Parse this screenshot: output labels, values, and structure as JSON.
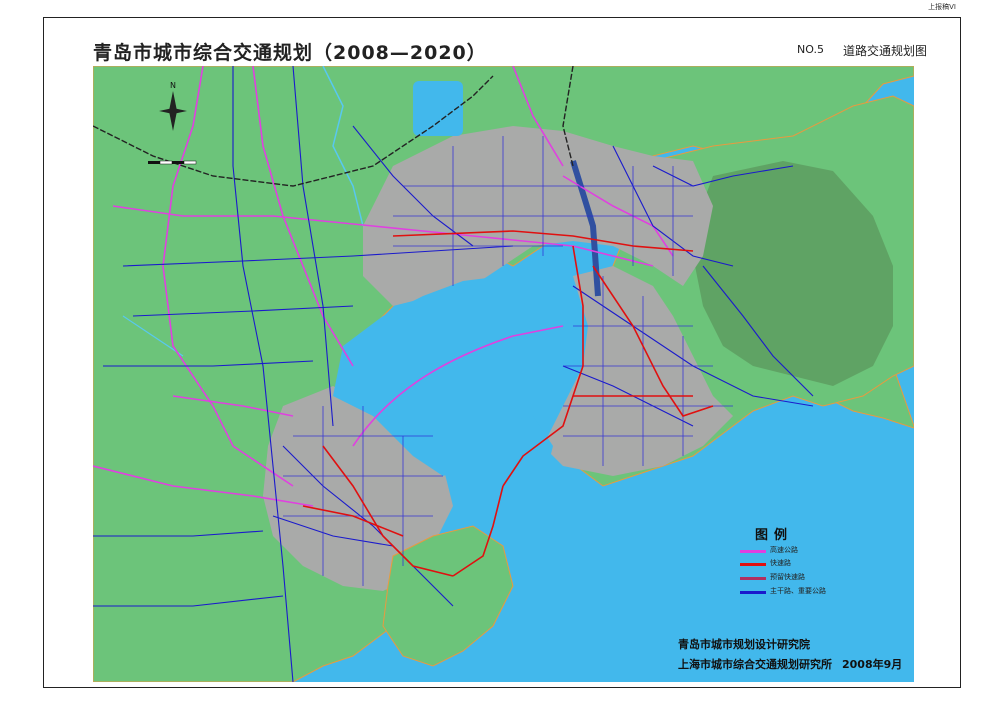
{
  "corner_note": "上报稿VI",
  "title": "青岛市城市综合交通规划（2008—2020）",
  "map_number": "NO.5",
  "map_name": "道路交通规划图",
  "compass_label": "N",
  "legend": {
    "title": "图例",
    "items": [
      {
        "label": "高速公路",
        "color": "#e040e0"
      },
      {
        "label": "快速路",
        "color": "#e01010"
      },
      {
        "label": "预留快速路",
        "color": "#b03060"
      },
      {
        "label": "主干路、重要公路",
        "color": "#1a1acc"
      }
    ]
  },
  "organizations": {
    "org1": "青岛市城市规划设计研究院",
    "org2": "上海市城市综合交通规划研究所",
    "date": "2008年9月"
  },
  "colors": {
    "water": "#42b8ec",
    "land": "#6cc47a",
    "urban": "#a9aaa9",
    "forest": "#5a9a5a",
    "coast_outline": "#e89a40"
  }
}
